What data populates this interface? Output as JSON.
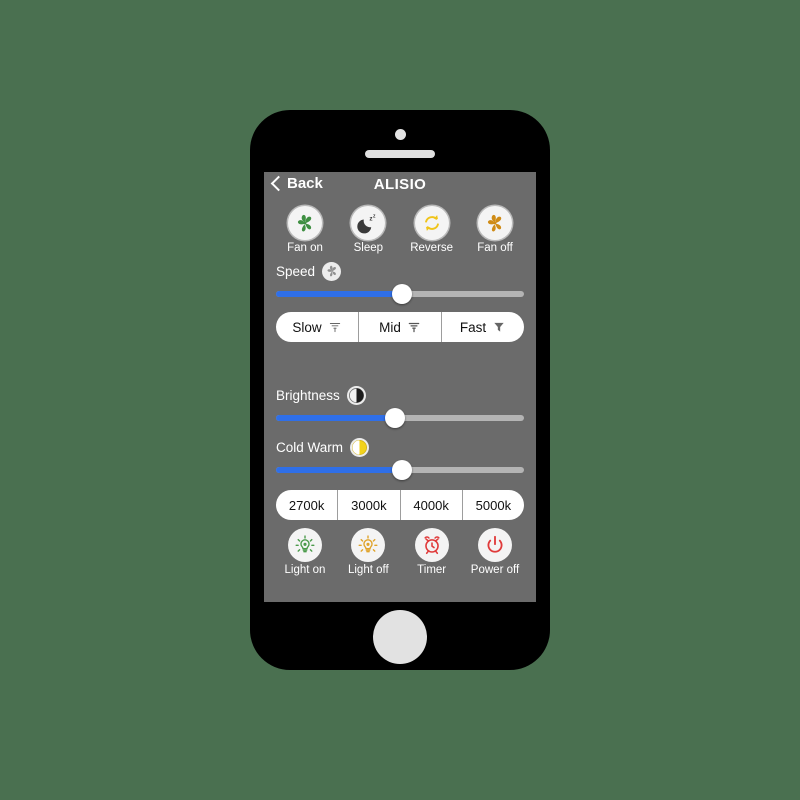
{
  "device": {
    "frame": "iphone",
    "camera_icon": "camera-dot",
    "speaker_icon": "speaker-grille",
    "home_button_icon": "home-button"
  },
  "colors": {
    "page_background": "#4a7050",
    "phone_body": "#000000",
    "screen_background": "#6b6b6b",
    "slider_fill": "#2f6fe8",
    "slider_track": "#b4b4b4",
    "fan_on": "#3f8f42",
    "fan_off": "#cf8b16",
    "reverse": "#f0c419",
    "light_on": "#4a9a4a",
    "light_off": "#e0a32a",
    "timer": "#e03b3b",
    "power_off": "#e03b3b",
    "cold_warm": "#f2d21c"
  },
  "navbar": {
    "back_label": "Back",
    "back_icon": "chevron-left-icon",
    "title": "ALISIO"
  },
  "fan_controls": [
    {
      "label": "Fan on",
      "icon": "fan-icon"
    },
    {
      "label": "Sleep",
      "icon": "moon-sleep-icon"
    },
    {
      "label": "Reverse",
      "icon": "reverse-arrows-icon"
    },
    {
      "label": "Fan off",
      "icon": "fan-icon"
    }
  ],
  "speed": {
    "label": "Speed",
    "icon": "fan-icon",
    "value_percent": 51,
    "presets": [
      {
        "label": "Slow",
        "icon": "wind-low-icon"
      },
      {
        "label": "Mid",
        "icon": "wind-mid-icon"
      },
      {
        "label": "Fast",
        "icon": "wind-high-icon"
      }
    ]
  },
  "brightness": {
    "label": "Brightness",
    "icon": "brightness-half-icon",
    "value_percent": 48
  },
  "cold_warm": {
    "label": "Cold Warm",
    "icon": "color-temperature-icon",
    "value_percent": 51
  },
  "color_temperatures": [
    {
      "label": "2700k"
    },
    {
      "label": "3000k"
    },
    {
      "label": "4000k"
    },
    {
      "label": "5000k"
    }
  ],
  "light_controls": [
    {
      "label": "Light on",
      "icon": "lightbulb-on-icon"
    },
    {
      "label": "Light off",
      "icon": "lightbulb-off-icon"
    },
    {
      "label": "Timer",
      "icon": "alarm-clock-icon"
    },
    {
      "label": "Power off",
      "icon": "power-icon"
    }
  ]
}
